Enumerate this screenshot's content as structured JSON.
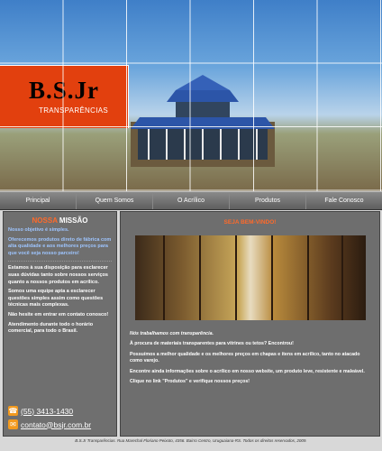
{
  "header": {
    "brand": "B.S.Jr",
    "tagline": "TRANSPARÊNCIAS"
  },
  "nav": {
    "items": [
      "Principal",
      "Quem Somos",
      "O Acrílico",
      "Produtos",
      "Fale Conosco"
    ]
  },
  "mission": {
    "title_a": "NOSSA",
    "title_b": "MISSÃO",
    "p1": "Nosso objetivo é simples.",
    "p2": "Oferecemos produtos direto de fábrica com alta qualidade e aos melhores preços para que você seja nosso parceiro!",
    "p3": "Estamos à sua disposição para esclarecer suas dúvidas tanto sobre nossos serviços quanto a nossos produtos em acrílico.",
    "p4": "Somos uma equipe apta a esclarecer questões simples assim como questões técnicas mais complexas.",
    "p5": "Não hesite em entrar em contato conosco!",
    "p6": "Atendimento durante todo o horário comercial, para todo o Brasil.",
    "phone": "(55) 3413-1430",
    "email": "contato@bsjr.com.br"
  },
  "main": {
    "welcome": "SEJA BEM-VINDO!",
    "p1": "Nós trabalhamos com transparência.",
    "p2": "À procura de materiais transparentes para vitrines ou tetos? Encontrou!",
    "p3": "Possuímos a melhor qualidade e os melhores preços em chapas e itens em acrílico, tanto no atacado como varejo.",
    "p4": "Encontre ainda informações sobre o acrílico em nosso website, um produto leve, resistente e maleável.",
    "p5": "Clique no link \"Produtos\" e verifique nossos preços!"
  },
  "footer": {
    "text": "B.S.Jr Transparências. Rua Marechal Floriano Peixoto, 4356. Bairro Centro, Uruguaiana-RS. Todos os direitos reservados, 2009."
  },
  "colors": {
    "accent": "#e2400e",
    "highlight": "#9ec5ff"
  }
}
